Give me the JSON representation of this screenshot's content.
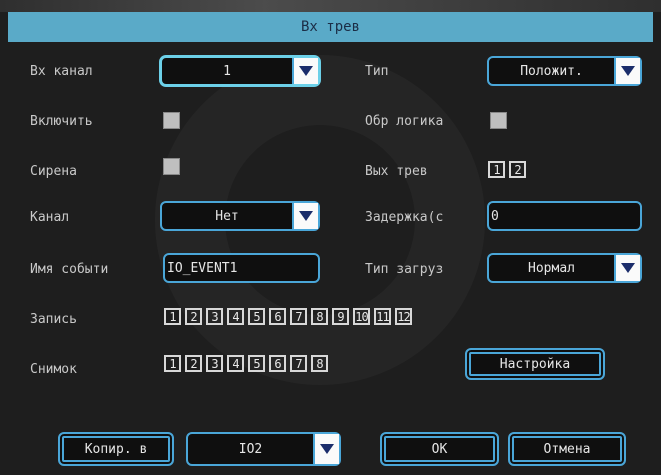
{
  "dialog": {
    "title": "Вх трев"
  },
  "left": {
    "input_channel": {
      "label": "Вх канал",
      "value": "1"
    },
    "enable": {
      "label": "Включить"
    },
    "siren": {
      "label": "Сирена"
    },
    "channel": {
      "label": "Канал",
      "value": "Нет"
    },
    "event_name": {
      "label": "Имя событи",
      "value": "IO_EVENT1"
    },
    "record": {
      "label": "Запись",
      "channels": [
        "1",
        "2",
        "3",
        "4",
        "5",
        "6",
        "7",
        "8",
        "9",
        "10",
        "11",
        "12"
      ]
    },
    "snapshot": {
      "label": "Снимок",
      "channels": [
        "1",
        "2",
        "3",
        "4",
        "5",
        "6",
        "7",
        "8"
      ]
    }
  },
  "right": {
    "type": {
      "label": "Тип",
      "value": "Положит."
    },
    "inverse_logic": {
      "label": "Обр логика"
    },
    "alarm_out": {
      "label": "Вых трев",
      "outputs": [
        "1",
        "2"
      ]
    },
    "delay": {
      "label": "Задержка(с",
      "value": "0"
    },
    "load_type": {
      "label": "Тип загруз",
      "value": "Нормал"
    },
    "setup_button": "Настройка"
  },
  "footer": {
    "copy_button": "Копир. в",
    "copy_target": "IO2",
    "ok_button": "OK",
    "cancel_button": "Отмена"
  },
  "colors": {
    "accent": "#4aa6d8",
    "title_bar": "#5aaac8",
    "background": "#1e1e1e"
  }
}
